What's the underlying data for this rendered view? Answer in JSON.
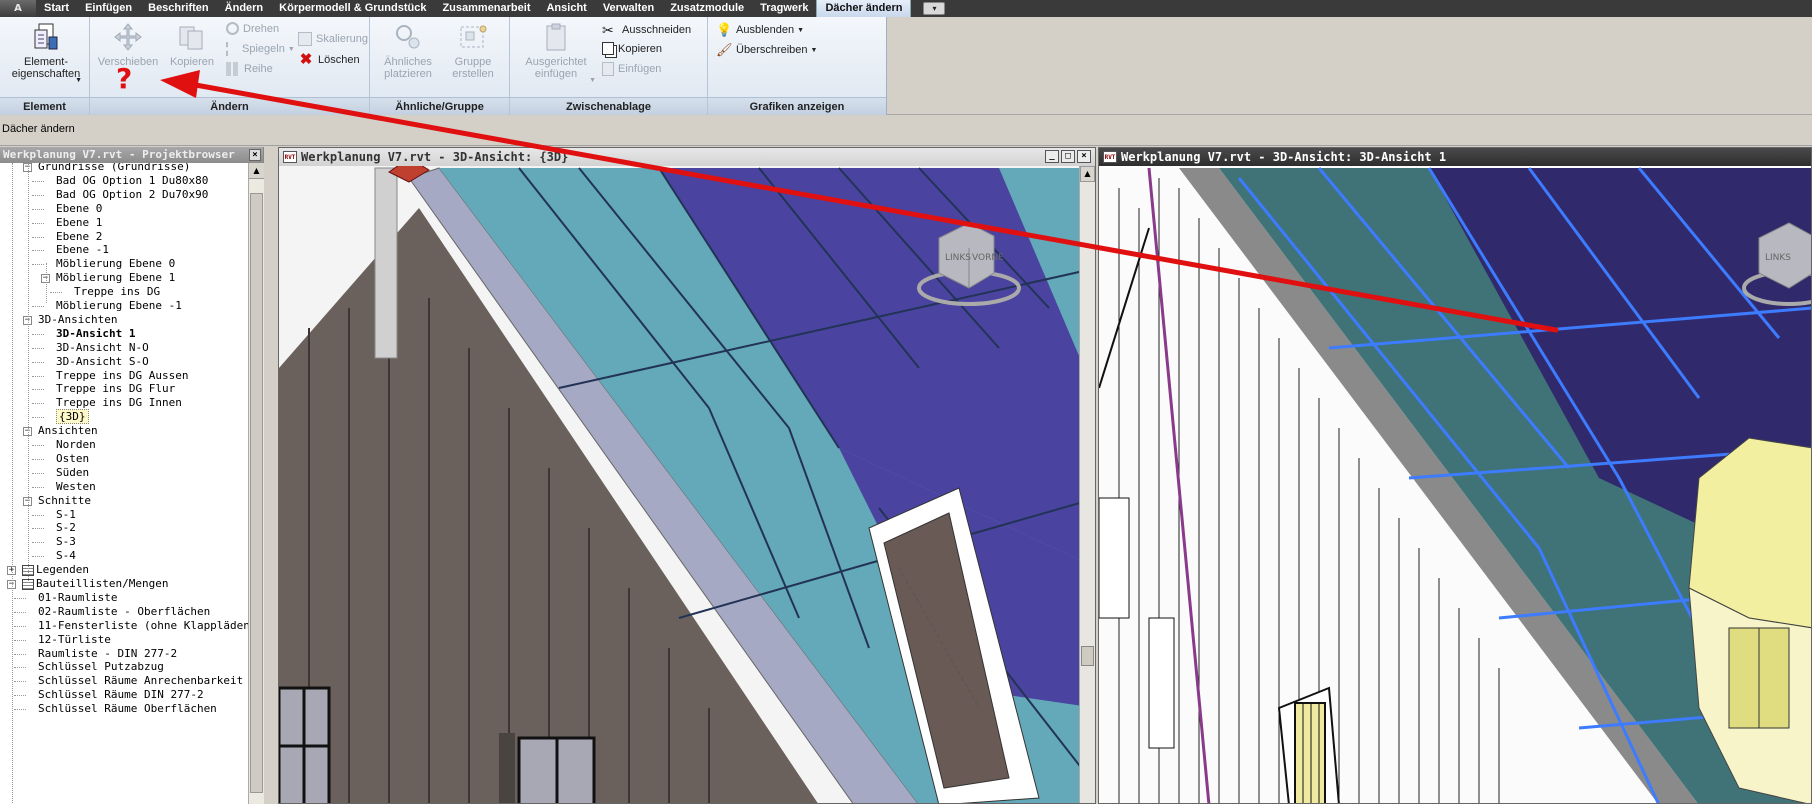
{
  "tabs": [
    "Start",
    "Einfügen",
    "Beschriften",
    "Ändern",
    "Körpermodell & Grundstück",
    "Zusammenarbeit",
    "Ansicht",
    "Verwalten",
    "Zusatzmodule",
    "Tragwerk",
    "Dächer ändern"
  ],
  "app_button": "A",
  "ribbon": {
    "element": {
      "label": "Element",
      "props": "Element-\neigenschaften"
    },
    "aendern": {
      "label": "Ändern",
      "verschieben": "Verschieben",
      "kopieren": "Kopieren",
      "drehen": "Drehen",
      "spiegeln": "Spiegeln",
      "reihe": "Reihe",
      "skalierung": "Skalierung",
      "loeschen": "Löschen"
    },
    "aehnliche": {
      "label": "Ähnliche/Gruppe",
      "platzieren": "Ähnliches\nplatzieren",
      "gruppe": "Gruppe\nerstellen"
    },
    "zwischen": {
      "label": "Zwischenablage",
      "einfuegen": "Ausgerichtet\neinfügen",
      "ausschneiden": "Ausschneiden",
      "kopieren": "Kopieren",
      "einfuegen2": "Einfügen"
    },
    "grafiken": {
      "label": "Grafiken anzeigen",
      "ausblenden": "Ausblenden",
      "ueberschreiben": "Überschreiben"
    }
  },
  "annotation": "?",
  "status": "Dächer ändern",
  "browser": {
    "title": "Werkplanung V7.rvt - Projektbrowser",
    "close": "×"
  },
  "tree": [
    {
      "t": "Grundrisse (Grundrisse)",
      "l": 1,
      "pm": "−"
    },
    {
      "t": "Bad OG Option 1 Du80x80",
      "l": 2
    },
    {
      "t": "Bad OG Option 2 Du70x90",
      "l": 2
    },
    {
      "t": "Ebene 0",
      "l": 2
    },
    {
      "t": "Ebene 1",
      "l": 2
    },
    {
      "t": "Ebene 2",
      "l": 2
    },
    {
      "t": "Ebene -1",
      "l": 2
    },
    {
      "t": "Möblierung Ebene 0",
      "l": 2
    },
    {
      "t": "Möblierung Ebene 1",
      "l": 2,
      "pm": "−"
    },
    {
      "t": "Treppe ins DG",
      "l": 3
    },
    {
      "t": "Möblierung Ebene -1",
      "l": 2
    },
    {
      "t": "3D-Ansichten",
      "l": 1,
      "pm": "−"
    },
    {
      "t": "3D-Ansicht 1",
      "l": 2,
      "b": true
    },
    {
      "t": "3D-Ansicht N-O",
      "l": 2
    },
    {
      "t": "3D-Ansicht S-O",
      "l": 2
    },
    {
      "t": "Treppe ins DG Aussen",
      "l": 2
    },
    {
      "t": "Treppe ins DG Flur",
      "l": 2
    },
    {
      "t": "Treppe ins DG Innen",
      "l": 2
    },
    {
      "t": "{3D}",
      "l": 2,
      "s": true
    },
    {
      "t": "Ansichten",
      "l": 1,
      "pm": "−"
    },
    {
      "t": "Norden",
      "l": 2
    },
    {
      "t": "Osten",
      "l": 2
    },
    {
      "t": "Süden",
      "l": 2
    },
    {
      "t": "Westen",
      "l": 2
    },
    {
      "t": "Schnitte",
      "l": 1,
      "pm": "−"
    },
    {
      "t": "S-1",
      "l": 2
    },
    {
      "t": "S-2",
      "l": 2
    },
    {
      "t": "S-3",
      "l": 2
    },
    {
      "t": "S-4",
      "l": 2
    },
    {
      "t": "Legenden",
      "l": 0,
      "pm": "+",
      "ico": true
    },
    {
      "t": "Bauteillisten/Mengen",
      "l": 0,
      "pm": "−",
      "ico": true
    },
    {
      "t": "01-Raumliste",
      "l": 1
    },
    {
      "t": "02-Raumliste - Oberflächen",
      "l": 1
    },
    {
      "t": "11-Fensterliste (ohne Klappläden)",
      "l": 1
    },
    {
      "t": "12-Türliste",
      "l": 1
    },
    {
      "t": "Raumliste - DIN 277-2",
      "l": 1
    },
    {
      "t": "Schlüssel Putzabzug",
      "l": 1
    },
    {
      "t": "Schlüssel Räume Anrechenbarkeit",
      "l": 1
    },
    {
      "t": "Schlüssel Räume DIN 277-2",
      "l": 1
    },
    {
      "t": "Schlüssel Räume Oberflächen",
      "l": 1
    }
  ],
  "view1": {
    "title": "Werkplanung V7.rvt - 3D-Ansicht: {3D}",
    "cube": [
      "LINKS",
      "VORNE"
    ]
  },
  "view2": {
    "title": "Werkplanung V7.rvt - 3D-Ansicht: 3D-Ansicht 1",
    "cube": [
      "LINKS"
    ]
  },
  "icons": {
    "app": "revit-app-icon",
    "min": "minimize-icon",
    "max": "maximize-icon",
    "close": "close-icon"
  },
  "colors": {
    "accent": "#e01010",
    "roof_teal": "#63a9b9",
    "roof_blue": "#4a44a0"
  }
}
